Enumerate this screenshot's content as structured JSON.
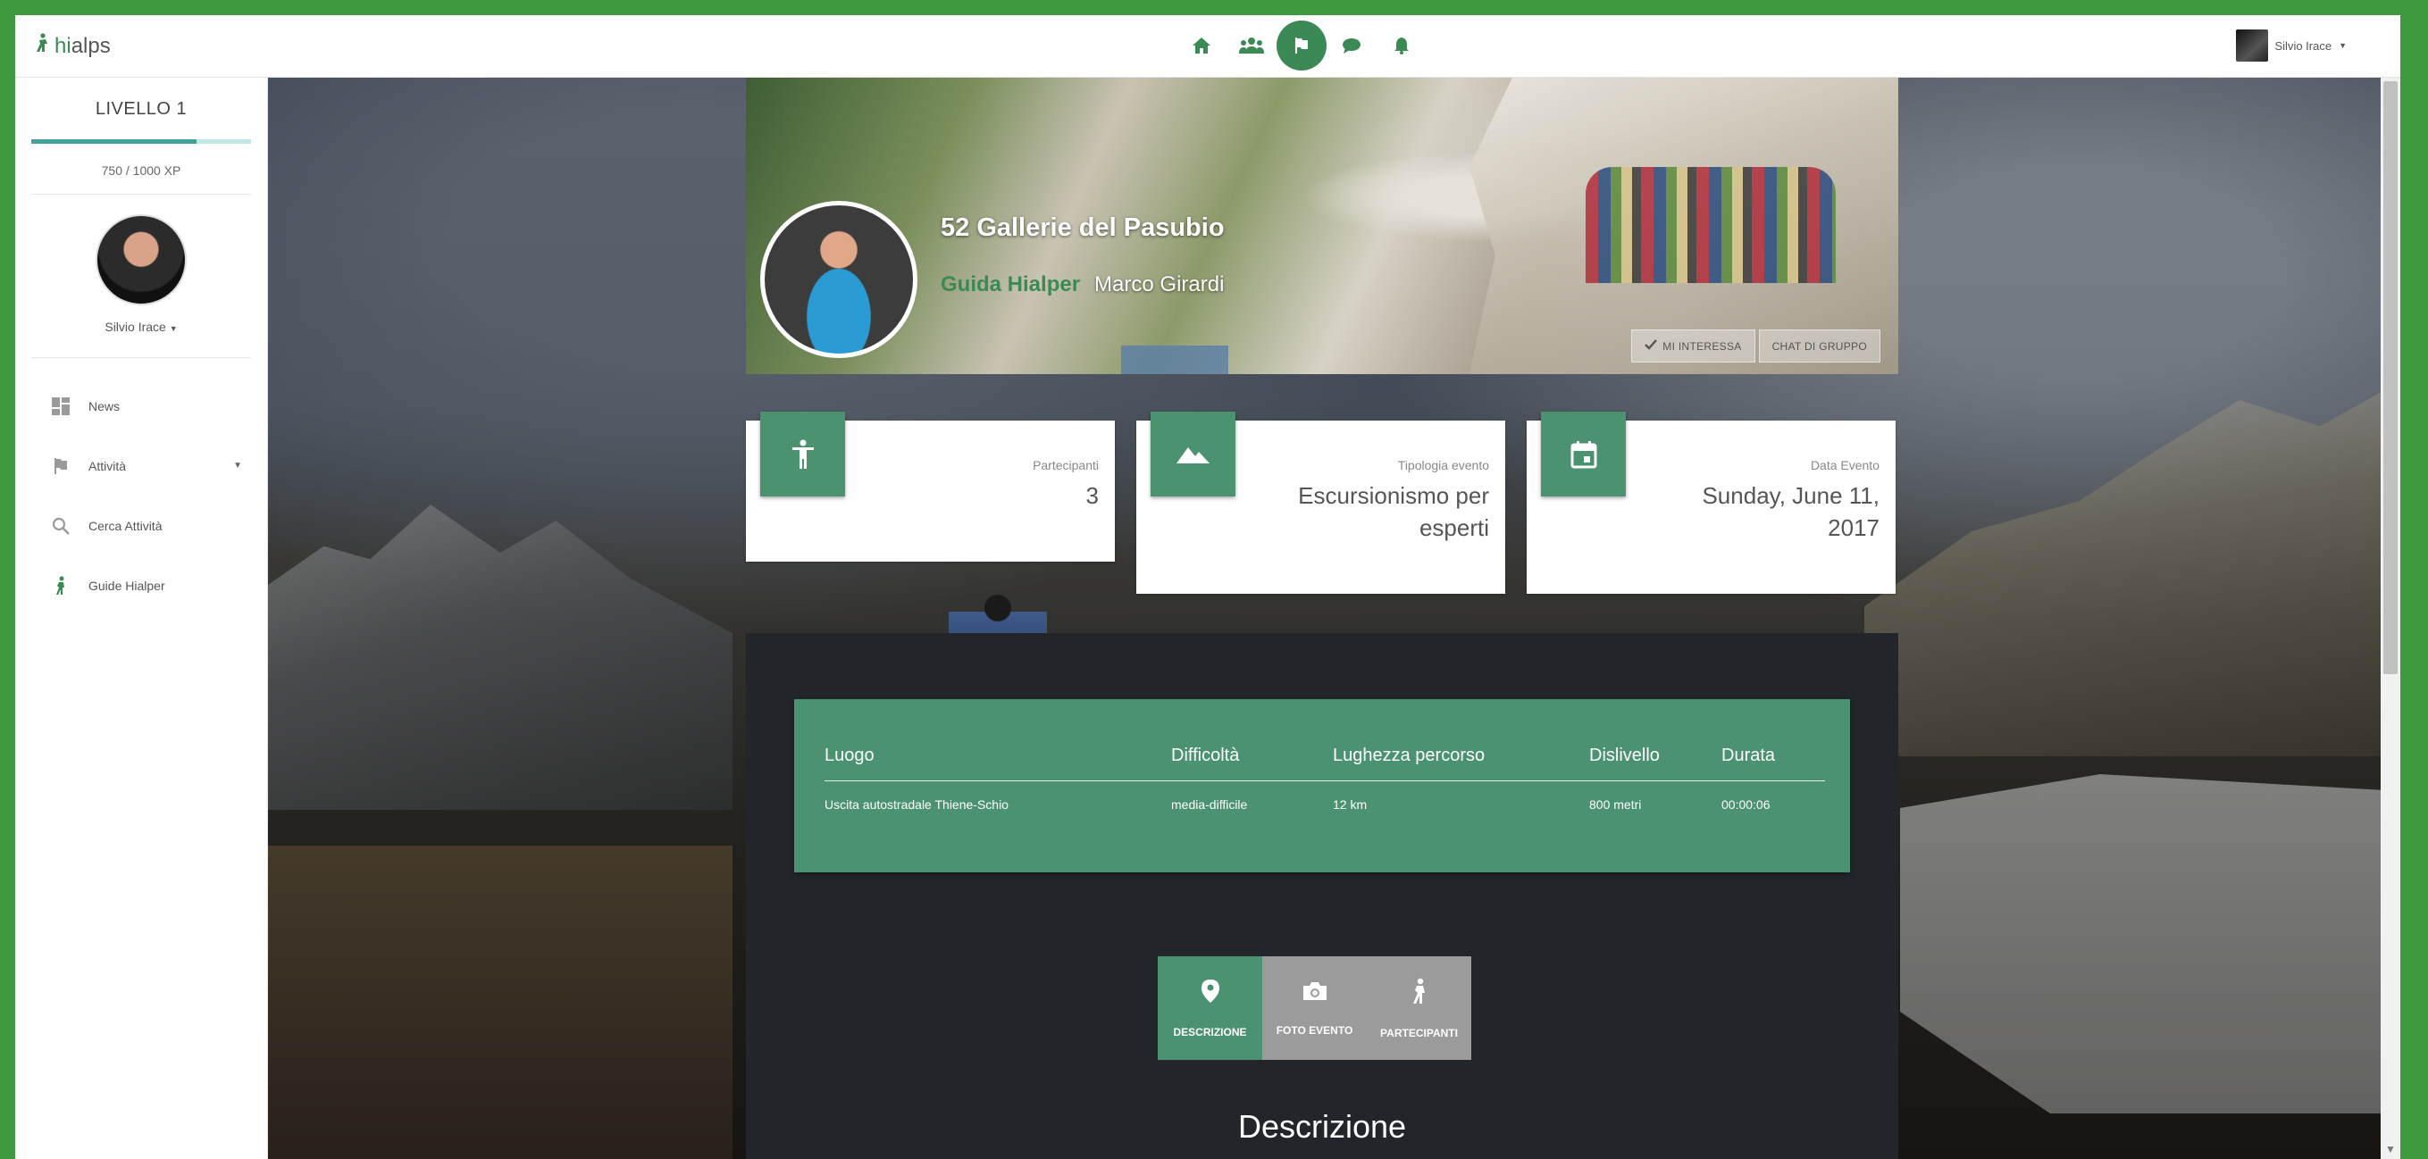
{
  "app": {
    "logo_prefix": "hi",
    "logo_suffix": "alps"
  },
  "topbar": {
    "nav_icons": [
      "home-icon",
      "group-icon",
      "flag-icon",
      "chat-icon",
      "bell-icon"
    ],
    "active_icon": "flag-icon",
    "user_name": "Silvio Irace"
  },
  "sidebar": {
    "level_label": "LIVELLO 1",
    "xp_text": "750 / 1000 XP",
    "xp_progress": 0.75,
    "username": "Silvio Irace",
    "menu": [
      {
        "label": "News",
        "icon": "dashboard-icon"
      },
      {
        "label": "Attività",
        "icon": "flag-icon",
        "has_caret": true
      },
      {
        "label": "Cerca Attività",
        "icon": "search-icon"
      },
      {
        "label": "Guide Hialper",
        "icon": "walker-icon"
      }
    ]
  },
  "event": {
    "title": "52 Gallerie del Pasubio",
    "guide_label": "Guida Hialper",
    "guide_name": "Marco Girardi",
    "interest_button": "MI INTERESSA",
    "group_chat_button": "CHAT DI GRUPPO"
  },
  "cards": [
    {
      "icon": "accessibility-icon",
      "label": "Partecipanti",
      "value": "3"
    },
    {
      "icon": "terrain-icon",
      "label": "Tipologia evento",
      "value": "Escursionismo per esperti"
    },
    {
      "icon": "calendar-icon",
      "label": "Data Evento",
      "value": "Sunday, June 11, 2017"
    }
  ],
  "details": {
    "headers": [
      "Luogo",
      "Difficoltà",
      "Lughezza percorso",
      "Dislivello",
      "Durata"
    ],
    "values": [
      "Uscita autostradale Thiene-Schio",
      "media-difficile",
      "12 km",
      "800 metri",
      "00:00:06"
    ]
  },
  "tabs": [
    {
      "label": "DESCRIZIONE",
      "icon": "location-pin-icon",
      "active": true
    },
    {
      "label": "FOTO EVENTO",
      "icon": "camera-icon",
      "active": false
    },
    {
      "label": "PARTECIPANTI",
      "icon": "walker-icon",
      "active": false
    }
  ],
  "section_title": "Descrizione",
  "colors": {
    "accent": "#3b8a55",
    "card_icon": "#4a9270",
    "panel": "#22262b",
    "tab_inactive": "#9b9b9b"
  }
}
